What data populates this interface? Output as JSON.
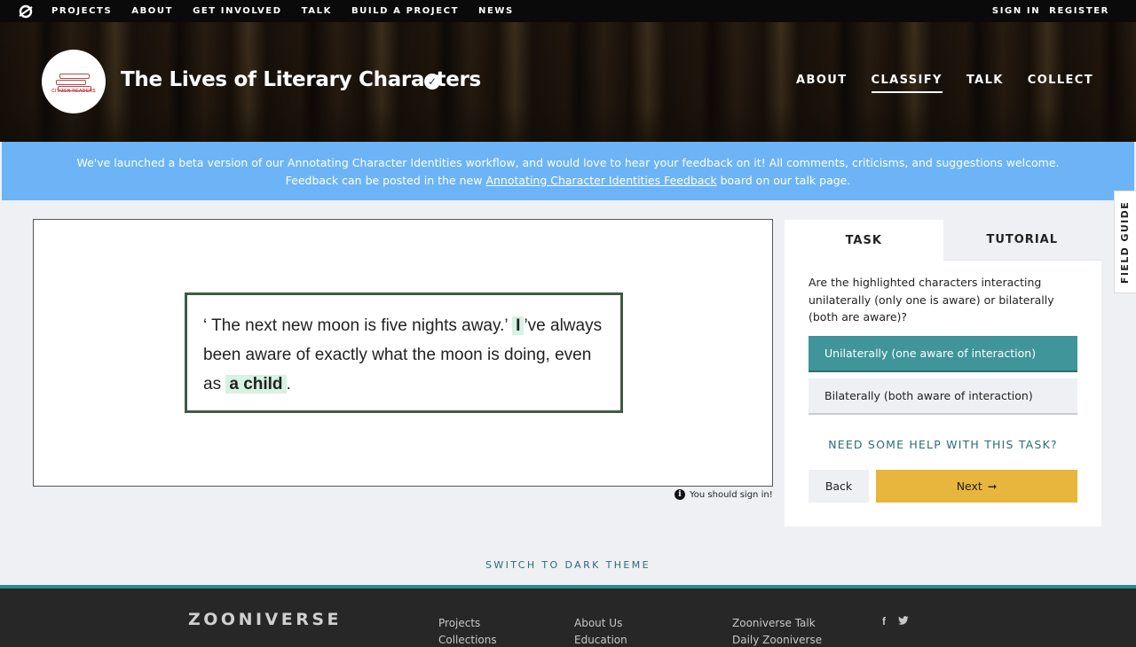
{
  "topnav": {
    "links": [
      "PROJECTS",
      "ABOUT",
      "GET INVOLVED",
      "TALK",
      "BUILD A PROJECT",
      "NEWS"
    ],
    "sign_in": "SIGN IN",
    "register": "REGISTER"
  },
  "project": {
    "title": "The Lives of Literary Characters",
    "logo_text": "CITIZEN READERS",
    "nav": [
      "ABOUT",
      "CLASSIFY",
      "TALK",
      "COLLECT"
    ],
    "active_nav": "CLASSIFY"
  },
  "banner": {
    "line1": "We've launched a beta version of our Annotating Character Identities workflow, and would love to hear your feedback on it! All comments, criticisms, and suggestions welcome.",
    "line2_before": "Feedback can be posted in the new ",
    "line2_link": "Annotating Character Identities Feedback",
    "line2_after": " board on our talk page."
  },
  "subject": {
    "text_1": "‘ The next new moon is five nights away.’",
    "highlight_1": "I",
    "text_2": "’ve always been aware of exactly what the moon is doing, even as",
    "highlight_2": "a child",
    "text_3": ".",
    "highlight_color": "#d6f2e2"
  },
  "sign_in_notice": "You should sign in!",
  "task_panel": {
    "tabs": [
      "TASK",
      "TUTORIAL"
    ],
    "question": "Are the highlighted characters interacting unilaterally (only one is aware) or bilaterally (both are aware)?",
    "answers": [
      "Unilaterally (one aware of interaction)",
      "Bilaterally (both aware of interaction)"
    ],
    "selected_answer": 0,
    "help_link": "NEED SOME HELP WITH THIS TASK?",
    "back_label": "Back",
    "next_label": "Next",
    "colors": {
      "selected": "#3f9599",
      "next": "#e8b53d"
    }
  },
  "field_guide": "FIELD GUIDE",
  "dark_theme": "SWITCH TO DARK THEME",
  "footer": {
    "logo": "ZOONIVERSE",
    "col1": [
      "Projects",
      "Collections"
    ],
    "col2": [
      "About Us",
      "Education"
    ],
    "col3": [
      "Zooniverse Talk",
      "Daily Zooniverse"
    ],
    "social_icons": [
      "facebook-icon",
      "twitter-icon"
    ]
  }
}
